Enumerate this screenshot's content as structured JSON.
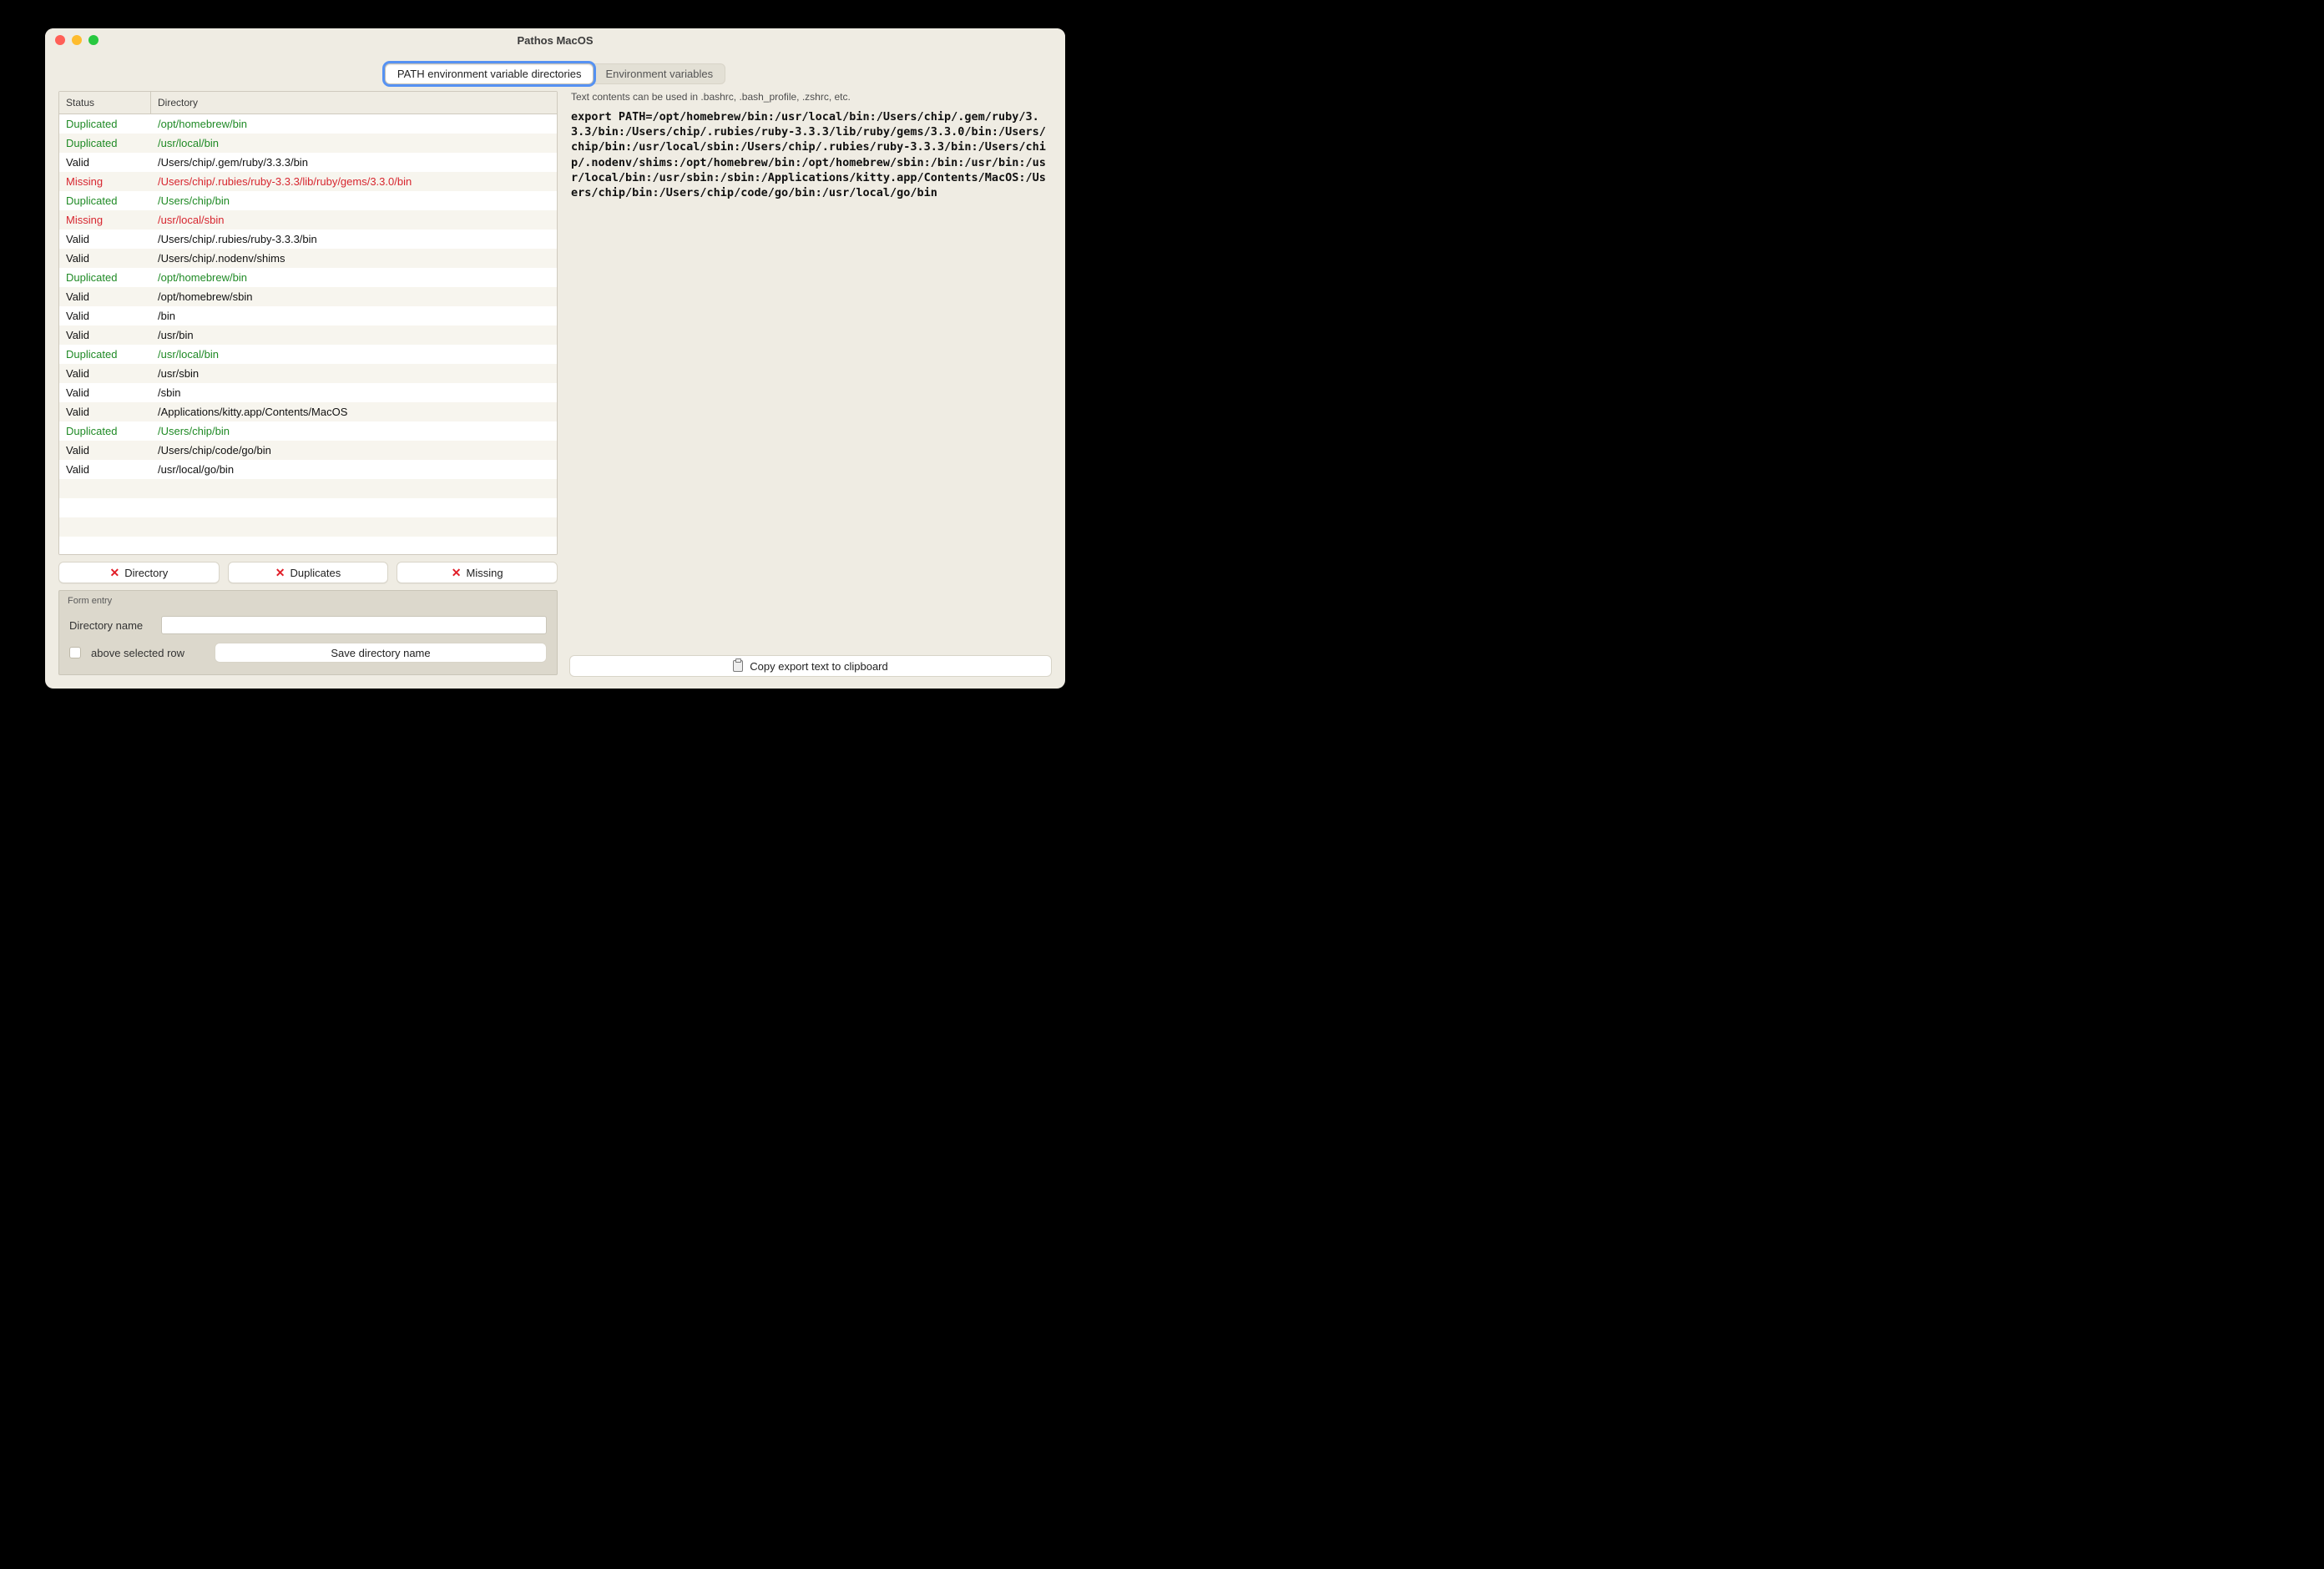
{
  "window": {
    "title": "Pathos MacOS"
  },
  "tabs": {
    "active": "PATH environment variable directories",
    "inactive": "Environment variables"
  },
  "table": {
    "headers": {
      "status": "Status",
      "directory": "Directory"
    },
    "status_labels": {
      "dup": "Duplicated",
      "valid": "Valid",
      "miss": "Missing"
    },
    "rows": [
      {
        "status": "dup",
        "dir": "/opt/homebrew/bin"
      },
      {
        "status": "dup",
        "dir": "/usr/local/bin"
      },
      {
        "status": "valid",
        "dir": "/Users/chip/.gem/ruby/3.3.3/bin"
      },
      {
        "status": "miss",
        "dir": "/Users/chip/.rubies/ruby-3.3.3/lib/ruby/gems/3.3.0/bin"
      },
      {
        "status": "dup",
        "dir": "/Users/chip/bin"
      },
      {
        "status": "miss",
        "dir": "/usr/local/sbin"
      },
      {
        "status": "valid",
        "dir": "/Users/chip/.rubies/ruby-3.3.3/bin"
      },
      {
        "status": "valid",
        "dir": "/Users/chip/.nodenv/shims"
      },
      {
        "status": "dup",
        "dir": "/opt/homebrew/bin"
      },
      {
        "status": "valid",
        "dir": "/opt/homebrew/sbin"
      },
      {
        "status": "valid",
        "dir": "/bin"
      },
      {
        "status": "valid",
        "dir": "/usr/bin"
      },
      {
        "status": "dup",
        "dir": "/usr/local/bin"
      },
      {
        "status": "valid",
        "dir": "/usr/sbin"
      },
      {
        "status": "valid",
        "dir": "/sbin"
      },
      {
        "status": "valid",
        "dir": "/Applications/kitty.app/Contents/MacOS"
      },
      {
        "status": "dup",
        "dir": "/Users/chip/bin"
      },
      {
        "status": "valid",
        "dir": "/Users/chip/code/go/bin"
      },
      {
        "status": "valid",
        "dir": "/usr/local/go/bin"
      }
    ]
  },
  "buttons": {
    "directory": "Directory",
    "duplicates": "Duplicates",
    "missing": "Missing"
  },
  "form": {
    "title": "Form entry",
    "directory_label": "Directory name",
    "above_label": "above selected row",
    "save_label": "Save directory name"
  },
  "right": {
    "desc": "Text contents can be used in .bashrc, .bash_profile, .zshrc, etc.",
    "export_text": "export PATH=/opt/homebrew/bin:/usr/local/bin:/Users/chip/.gem/ruby/3.3.3/bin:/Users/chip/.rubies/ruby-3.3.3/lib/ruby/gems/3.3.0/bin:/Users/chip/bin:/usr/local/sbin:/Users/chip/.rubies/ruby-3.3.3/bin:/Users/chip/.nodenv/shims:/opt/homebrew/bin:/opt/homebrew/sbin:/bin:/usr/bin:/usr/local/bin:/usr/sbin:/sbin:/Applications/kitty.app/Contents/MacOS:/Users/chip/bin:/Users/chip/code/go/bin:/usr/local/go/bin",
    "copy_label": "Copy export text to clipboard"
  }
}
